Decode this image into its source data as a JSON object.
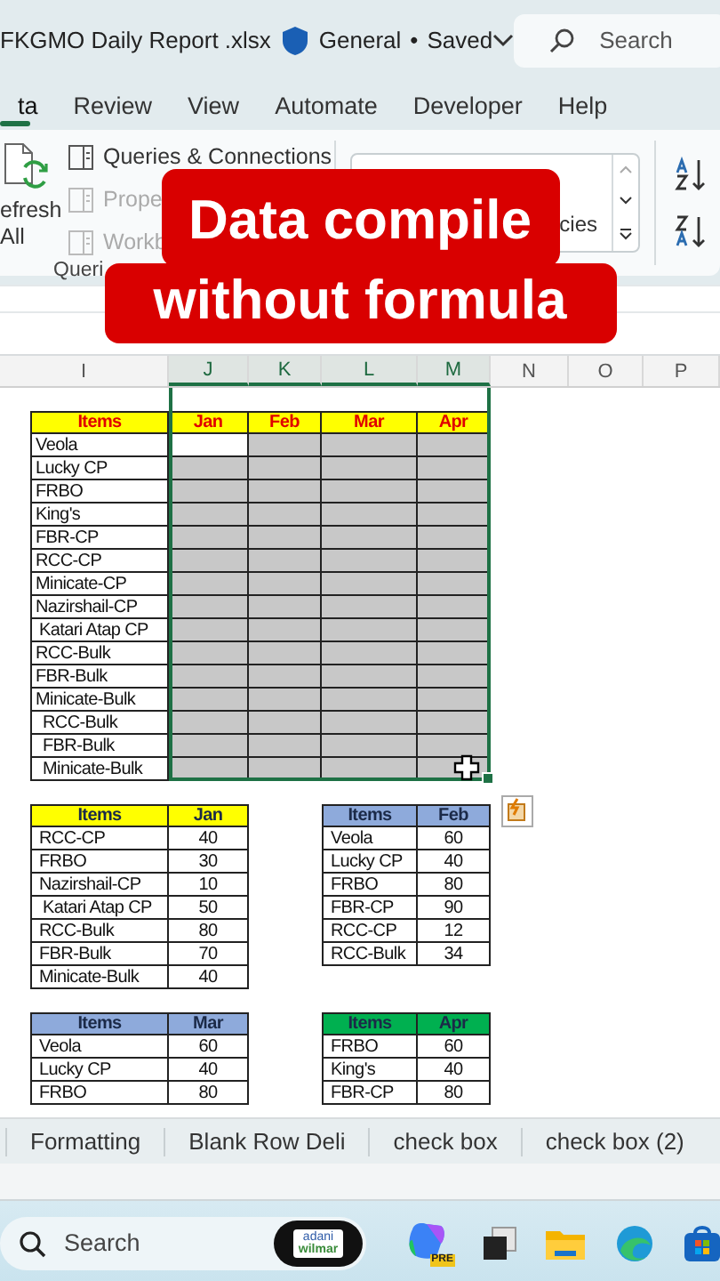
{
  "title_bar": {
    "file_name": "FKGMO Daily Report .xlsx",
    "sensitivity": "General",
    "separator": "•",
    "save_status": "Saved",
    "search": {
      "placeholder": "Search"
    }
  },
  "tabs": [
    {
      "label": "ta",
      "selected": true
    },
    {
      "label": "Review",
      "selected": false
    },
    {
      "label": "View",
      "selected": false
    },
    {
      "label": "Automate",
      "selected": false
    },
    {
      "label": "Developer",
      "selected": false
    },
    {
      "label": "Help",
      "selected": false
    }
  ],
  "ribbon": {
    "refresh_label": "efresh",
    "refresh_label_2": "All",
    "queries": [
      {
        "label": "Queries & Connections",
        "disabled": false
      },
      {
        "label": "Prope",
        "disabled": true
      },
      {
        "label": "Workb",
        "disabled": true
      }
    ],
    "group_label": "Queri",
    "data_types_label": "cies"
  },
  "caption": [
    "Data compile",
    "without formula"
  ],
  "sheet": {
    "column_headers": [
      "I",
      "J",
      "K",
      "L",
      "M",
      "N",
      "O",
      "P"
    ],
    "summary_table": {
      "color": "#ffff00",
      "headers": [
        "Items",
        "Jan",
        "Feb",
        "Mar",
        "Apr"
      ],
      "rows": [
        {
          "item": "Veola",
          "indented": false,
          "active": true
        },
        {
          "item": "Lucky CP",
          "indented": false,
          "active": false
        },
        {
          "item": "FRBO",
          "indented": false,
          "active": false
        },
        {
          "item": "King's",
          "indented": false,
          "active": false
        },
        {
          "item": "FBR-CP",
          "indented": false,
          "active": false
        },
        {
          "item": "RCC-CP",
          "indented": false,
          "active": false
        },
        {
          "item": "Minicate-CP",
          "indented": false,
          "active": false
        },
        {
          "item": "Nazirshail-CP",
          "indented": false,
          "active": false
        },
        {
          "item": "Katari Atap CP",
          "indented": true,
          "active": false
        },
        {
          "item": "RCC-Bulk",
          "indented": false,
          "active": false
        },
        {
          "item": "FBR-Bulk",
          "indented": false,
          "active": false
        },
        {
          "item": "Minicate-Bulk",
          "indented": false,
          "active": false
        },
        {
          "item": "RCC-Bulk",
          "indented": true,
          "active": false
        },
        {
          "item": "FBR-Bulk",
          "indented": true,
          "active": false
        },
        {
          "item": "Minicate-Bulk",
          "indented": true,
          "active": false
        }
      ]
    },
    "month_tables": [
      {
        "color": "#ffff00",
        "headers": [
          "Items",
          "Jan"
        ],
        "rows": [
          {
            "item": "RCC-CP",
            "value": "40",
            "indented": false
          },
          {
            "item": "FRBO",
            "value": "30",
            "indented": false
          },
          {
            "item": "Nazirshail-CP",
            "value": "10",
            "indented": false
          },
          {
            "item": "Katari Atap CP",
            "value": "50",
            "indented": true
          },
          {
            "item": "RCC-Bulk",
            "value": "80",
            "indented": false
          },
          {
            "item": "FBR-Bulk",
            "value": "70",
            "indented": false
          },
          {
            "item": "Minicate-Bulk",
            "value": "40",
            "indented": false
          }
        ]
      },
      {
        "color": "#8eaadb",
        "headers": [
          "Items",
          "Feb"
        ],
        "rows": [
          {
            "item": "Veola",
            "value": "60",
            "indented": false
          },
          {
            "item": "Lucky CP",
            "value": "40",
            "indented": false
          },
          {
            "item": "FRBO",
            "value": "80",
            "indented": false
          },
          {
            "item": "FBR-CP",
            "value": "90",
            "indented": false
          },
          {
            "item": "RCC-CP",
            "value": "12",
            "indented": false
          },
          {
            "item": "RCC-Bulk",
            "value": "34",
            "indented": false
          }
        ]
      },
      {
        "color": "#8eaadb",
        "headers": [
          "Items",
          "Mar"
        ],
        "rows": [
          {
            "item": "Veola",
            "value": "60",
            "indented": false
          },
          {
            "item": "Lucky CP",
            "value": "40",
            "indented": false
          },
          {
            "item": "FRBO",
            "value": "80",
            "indented": false
          }
        ]
      },
      {
        "color": "#00b050",
        "headers": [
          "Items",
          "Apr"
        ],
        "rows": [
          {
            "item": "FRBO",
            "value": "60",
            "indented": false
          },
          {
            "item": "King's",
            "value": "40",
            "indented": false
          },
          {
            "item": "FBR-CP",
            "value": "80",
            "indented": false
          }
        ]
      }
    ]
  },
  "sheet_tabs": [
    {
      "label": "Formatting"
    },
    {
      "label": "Blank Row Deli"
    },
    {
      "label": "check box"
    },
    {
      "label": "check box (2)"
    }
  ],
  "taskbar": {
    "search": {
      "placeholder": "Search"
    },
    "badge": [
      "adani",
      "wilmar"
    ],
    "copilot_badge": "PRE"
  }
}
